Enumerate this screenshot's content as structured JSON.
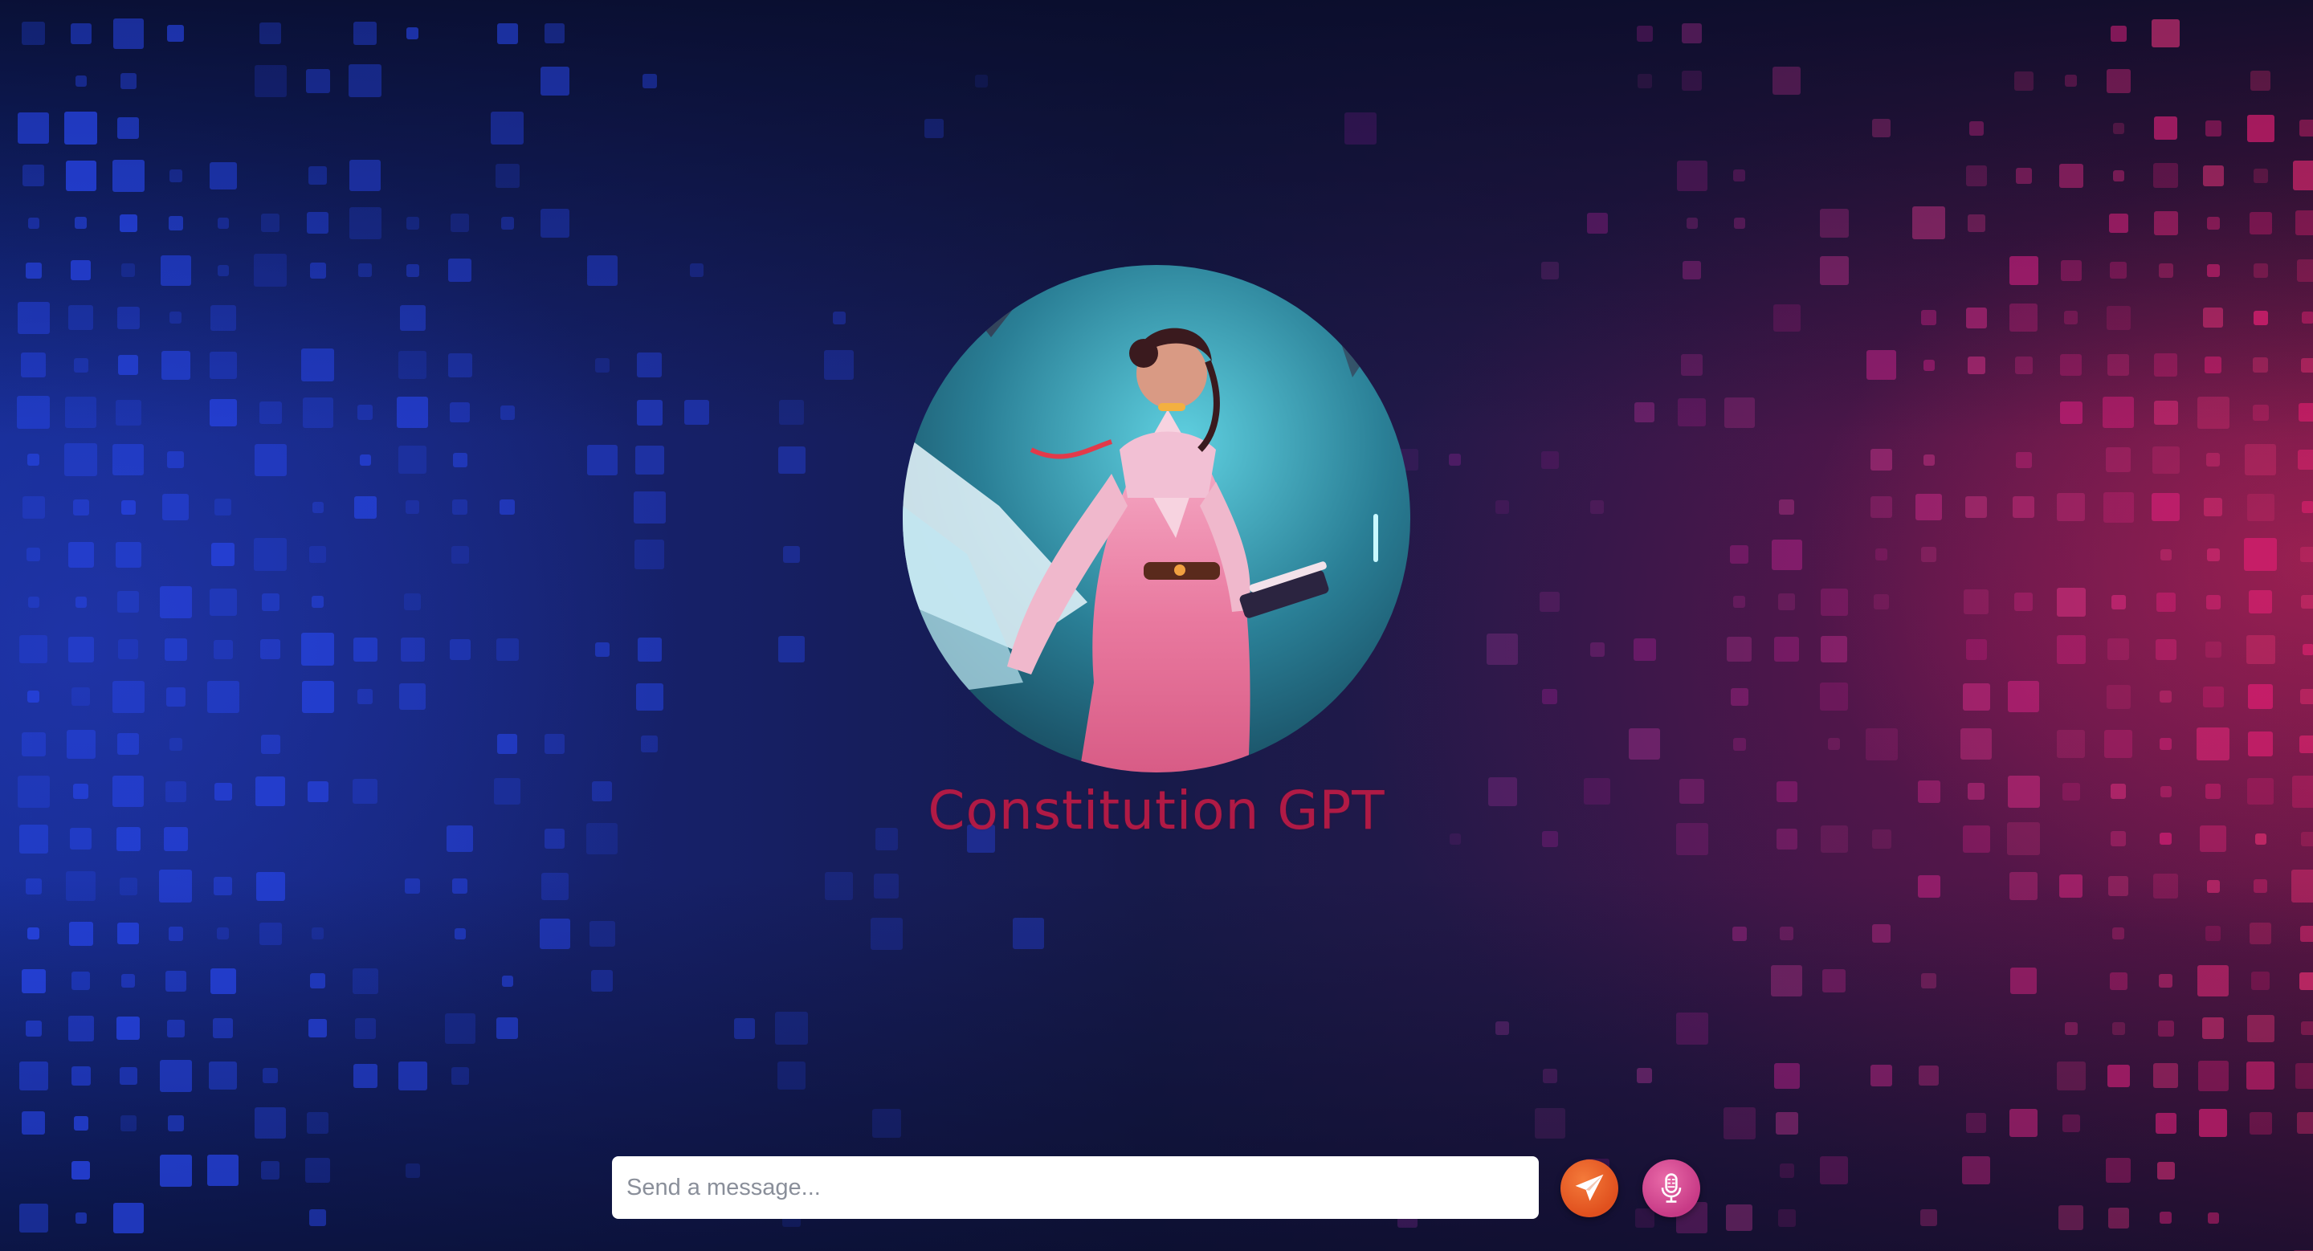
{
  "app": {
    "title": "Constitution GPT",
    "avatar_alt": "avatar"
  },
  "composer": {
    "placeholder": "Send a message...",
    "value": "",
    "send_icon": "paper-plane-icon",
    "mic_icon": "microphone-icon"
  },
  "colors": {
    "title": "#b01a45",
    "send_button": "#e85a24",
    "mic_button": "#d24a93",
    "background_left": "#132a8c",
    "background_right": "#5a1642"
  }
}
